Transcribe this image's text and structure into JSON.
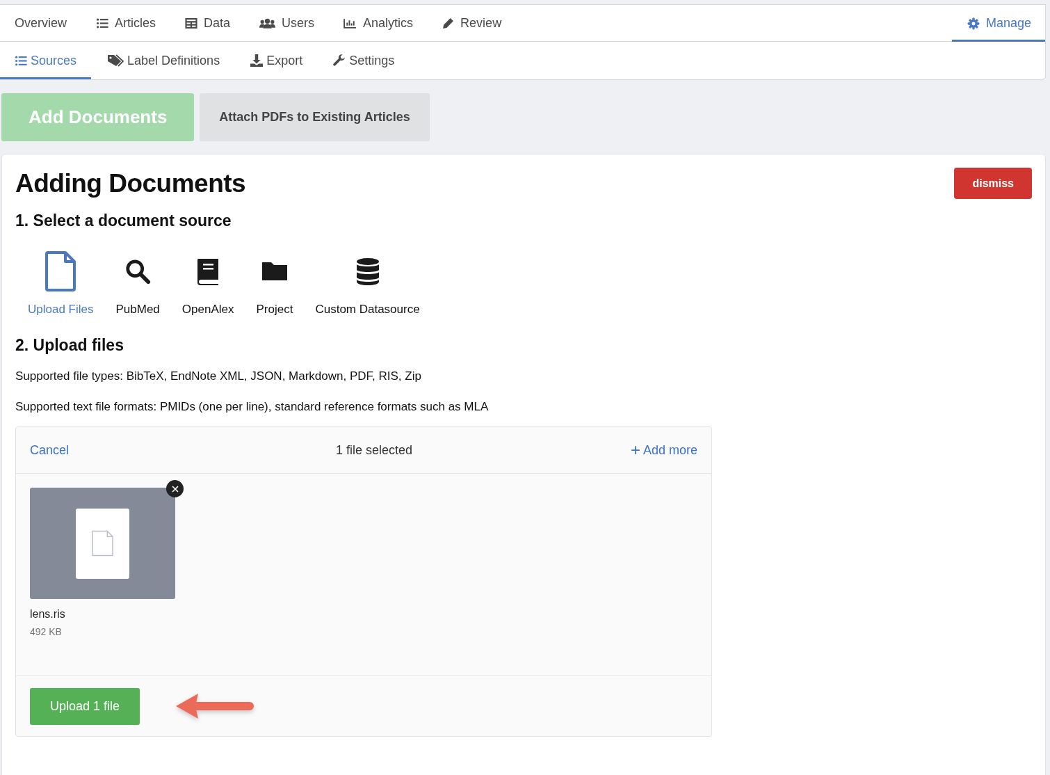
{
  "main_tabs": [
    {
      "label": "Overview",
      "selected": false
    },
    {
      "label": "Articles",
      "selected": false
    },
    {
      "label": "Data",
      "selected": false
    },
    {
      "label": "Users",
      "selected": false
    },
    {
      "label": "Analytics",
      "selected": false
    },
    {
      "label": "Review",
      "selected": false
    },
    {
      "label": "Manage",
      "selected": true
    }
  ],
  "sub_tabs": [
    {
      "label": "Sources",
      "selected": true
    },
    {
      "label": "Label Definitions",
      "selected": false
    },
    {
      "label": "Export",
      "selected": false
    },
    {
      "label": "Settings",
      "selected": false
    }
  ],
  "mode_buttons": [
    {
      "label": "Add Documents",
      "selected": true
    },
    {
      "label": "Attach PDFs to Existing Articles",
      "selected": false
    }
  ],
  "panel": {
    "title": "Adding Documents",
    "dismiss": "dismiss",
    "step1": "1. Select a document source",
    "sources": [
      {
        "label": "Upload Files",
        "selected": true
      },
      {
        "label": "PubMed",
        "selected": false
      },
      {
        "label": "OpenAlex",
        "selected": false
      },
      {
        "label": "Project",
        "selected": false
      },
      {
        "label": "Custom Datasource",
        "selected": false
      }
    ],
    "step2": "2. Upload files",
    "notes": [
      "Supported file types: BibTeX, EndNote XML, JSON, Markdown, PDF, RIS, Zip",
      "Supported text file formats: PMIDs (one per line), standard reference formats such as MLA"
    ],
    "uploader": {
      "cancel": "Cancel",
      "status": "1 file selected",
      "add_more_icon": "+",
      "add_more": "Add more",
      "files": [
        {
          "name": "lens.ris",
          "size": "492 KB"
        }
      ],
      "upload_button": "Upload 1 file"
    }
  }
}
